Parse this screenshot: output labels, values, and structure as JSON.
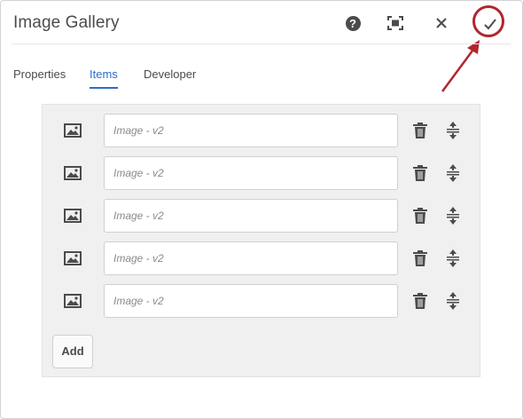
{
  "dialog": {
    "title": "Image Gallery",
    "help_symbol": "?"
  },
  "tabs": [
    {
      "label": "Properties",
      "active": false
    },
    {
      "label": "Items",
      "active": true
    },
    {
      "label": "Developer",
      "active": false
    }
  ],
  "items": [
    {
      "placeholder": "Image - v2"
    },
    {
      "placeholder": "Image - v2"
    },
    {
      "placeholder": "Image - v2"
    },
    {
      "placeholder": "Image - v2"
    },
    {
      "placeholder": "Image - v2"
    }
  ],
  "add_label": "Add",
  "colors": {
    "accent": "#2d6ec9",
    "annotation": "#b0272d",
    "panel_bg": "#f0f0f0"
  },
  "icons": [
    "help-icon",
    "fullscreen-icon",
    "close-icon",
    "checkmark-icon",
    "image-icon",
    "trash-icon",
    "drag-handle-icon"
  ]
}
